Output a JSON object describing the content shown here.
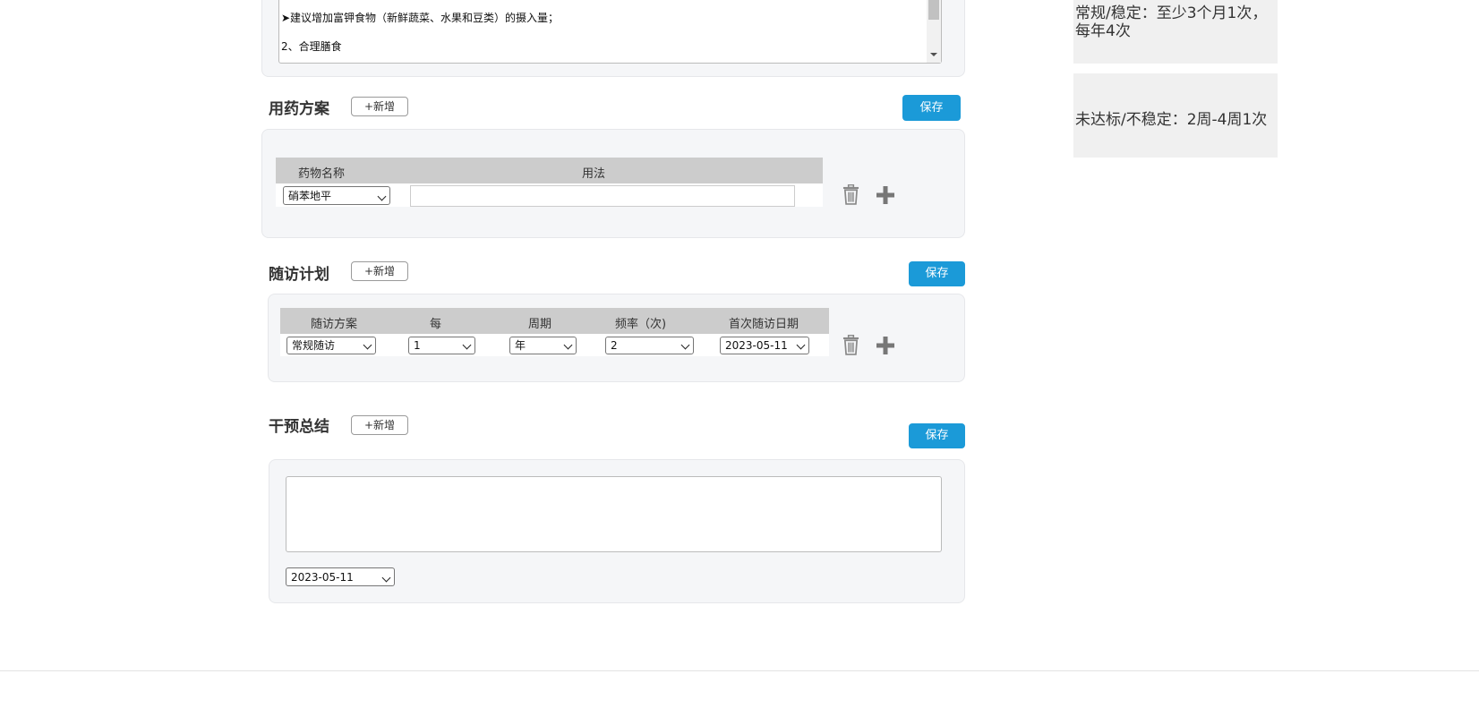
{
  "notes": {
    "line1": "➤建议增加富钾食物（新鲜蔬菜、水果和豆类）的摄入量；",
    "line2": "2、合理膳食"
  },
  "medication": {
    "title": "用药方案",
    "add_label": "+新增",
    "save_label": "保存",
    "col_name": "药物名称",
    "col_usage": "用法",
    "row": {
      "drug": "硝苯地平",
      "usage": ""
    }
  },
  "followup": {
    "title": "随访计划",
    "add_label": "+新增",
    "save_label": "保存",
    "headers": [
      "随访方案",
      "每",
      "周期",
      "频率（次)",
      "首次随访日期"
    ],
    "row": {
      "plan": "常规随访",
      "every": "1",
      "period": "年",
      "frequency": "2",
      "first_date": "2023-05-11"
    }
  },
  "summary": {
    "title": "干预总结",
    "add_label": "+新增",
    "save_label": "保存",
    "text": "",
    "date": "2023-05-11"
  },
  "sidebar": {
    "stable_text": "常规/稳定：至少3个月1次，每年4次",
    "unstable_text": "未达标/不稳定：2周-4周1次"
  }
}
